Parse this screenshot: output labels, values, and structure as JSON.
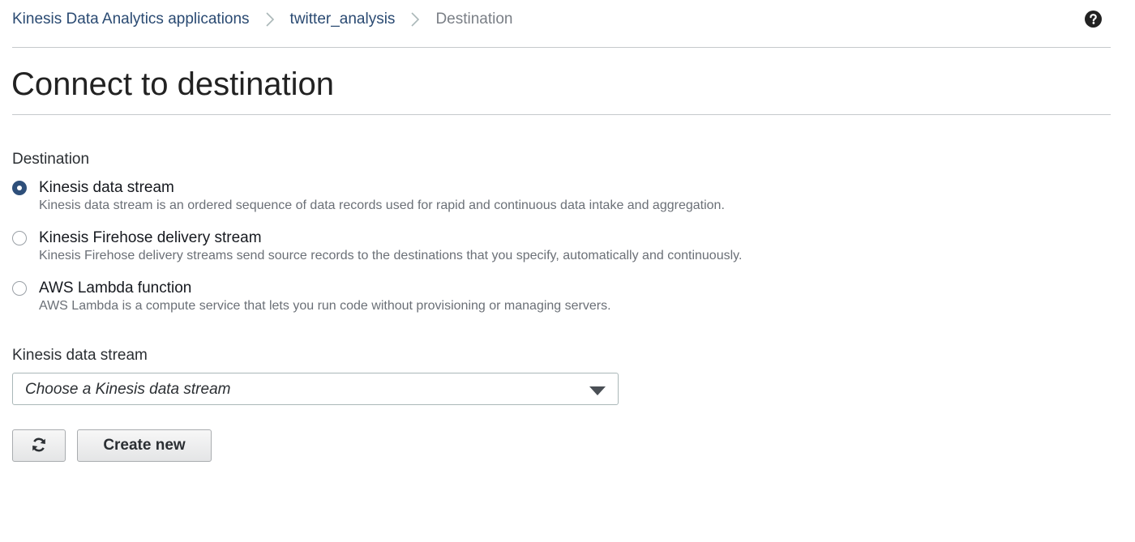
{
  "breadcrumb": {
    "items": [
      {
        "label": "Kinesis Data Analytics applications"
      },
      {
        "label": "twitter_analysis"
      },
      {
        "label": "Destination"
      }
    ]
  },
  "page": {
    "title": "Connect to destination"
  },
  "destination": {
    "label": "Destination",
    "options": [
      {
        "title": "Kinesis data stream",
        "description": "Kinesis data stream is an ordered sequence of data records used for rapid and continuous data intake and aggregation.",
        "selected": true
      },
      {
        "title": "Kinesis Firehose delivery stream",
        "description": "Kinesis Firehose delivery streams send source records to the destinations that you specify, automatically and continuously.",
        "selected": false
      },
      {
        "title": "AWS Lambda function",
        "description": "AWS Lambda is a compute service that lets you run code without provisioning or managing servers.",
        "selected": false
      }
    ]
  },
  "stream": {
    "label": "Kinesis data stream",
    "placeholder": "Choose a Kinesis data stream"
  },
  "actions": {
    "refresh_icon": "refresh-icon",
    "create_label": "Create new"
  },
  "colors": {
    "link": "#2a4a72",
    "radio_selected": "#2e4f7a",
    "muted_text": "#6b7077"
  }
}
